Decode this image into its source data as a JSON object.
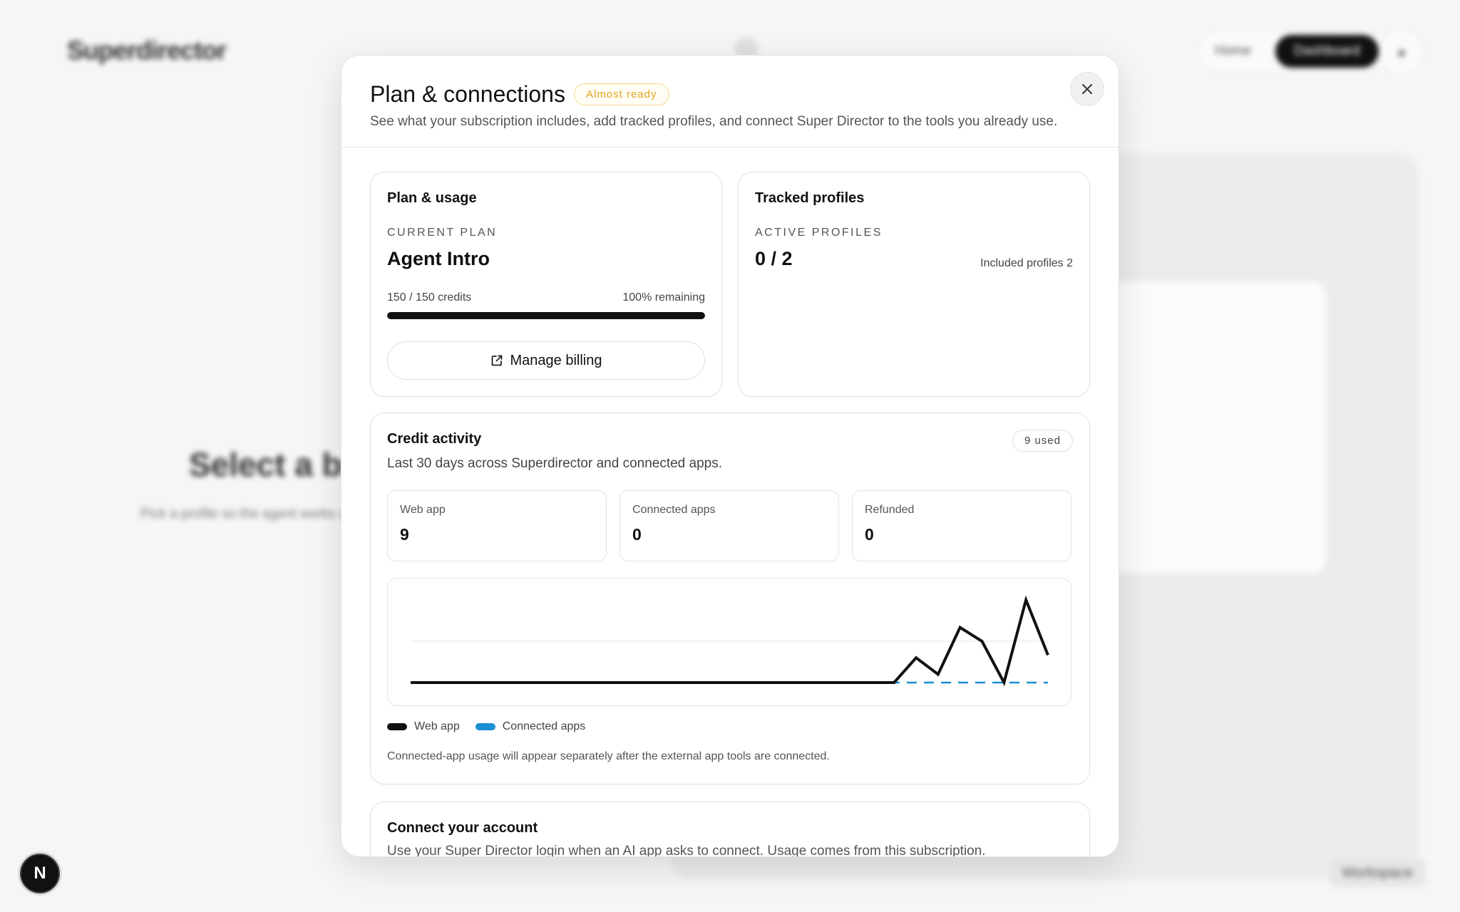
{
  "background": {
    "logo": "Superdirector",
    "nav_home": "Home",
    "nav_dashboard": "Dashboard",
    "center_title": "Select a br",
    "center_subtitle": "Pick a profile so the agent works and team perf",
    "workspace_label": "Workspace"
  },
  "dev_badge": {
    "letter": "N"
  },
  "modal": {
    "title": "Plan & connections",
    "status_badge": "Almost ready",
    "description": "See what your subscription includes, add tracked profiles, and connect Super Director to the tools you already use.",
    "close_icon": "close-icon"
  },
  "plan": {
    "title": "Plan & usage",
    "eyebrow": "CURRENT PLAN",
    "plan_name": "Agent Intro",
    "credits_text": "150 / 150 credits",
    "remaining_text": "100% remaining",
    "remaining_fraction": 1.0,
    "billing_label": "Manage billing",
    "billing_icon": "external-link-icon"
  },
  "profiles": {
    "title": "Tracked profiles",
    "eyebrow": "ACTIVE PROFILES",
    "value": "0 / 2",
    "included_text": "Included profiles 2"
  },
  "activity": {
    "title": "Credit activity",
    "used_badge": "9 used",
    "subtitle": "Last 30 days across Superdirector and connected apps.",
    "stats": [
      {
        "label": "Web app",
        "value": "9"
      },
      {
        "label": "Connected apps",
        "value": "0"
      },
      {
        "label": "Refunded",
        "value": "0"
      }
    ],
    "legend": [
      {
        "label": "Web app",
        "color": "#111111"
      },
      {
        "label": "Connected apps",
        "color": "#1a8fd1"
      }
    ],
    "footnote": "Connected-app usage will appear separately after the external app tools are connected."
  },
  "chart_data": {
    "type": "line",
    "x": [
      1,
      2,
      3,
      4,
      5,
      6,
      7,
      8,
      9,
      10,
      11,
      12,
      13,
      14,
      15,
      16,
      17,
      18,
      19,
      20,
      21,
      22,
      23,
      24,
      25,
      26,
      27,
      28,
      29,
      30
    ],
    "series": [
      {
        "name": "Web app",
        "color": "#111111",
        "values": [
          0,
          0,
          0,
          0,
          0,
          0,
          0,
          0,
          0,
          0,
          0,
          0,
          0,
          0,
          0,
          0,
          0,
          0,
          0,
          0,
          0,
          0,
          0,
          0.9,
          0.3,
          2,
          1.5,
          0,
          3,
          1
        ]
      },
      {
        "name": "Connected apps",
        "color": "#1a8fd1",
        "values": [
          0,
          0,
          0,
          0,
          0,
          0,
          0,
          0,
          0,
          0,
          0,
          0,
          0,
          0,
          0,
          0,
          0,
          0,
          0,
          0,
          0,
          0,
          0,
          0,
          0,
          0,
          0,
          0,
          0,
          0
        ]
      }
    ],
    "ylim": [
      0,
      3
    ],
    "grid": true
  },
  "connect": {
    "title": "Connect your account",
    "subtitle": "Use your Super Director login when an AI app asks to connect. Usage comes from this subscription."
  }
}
